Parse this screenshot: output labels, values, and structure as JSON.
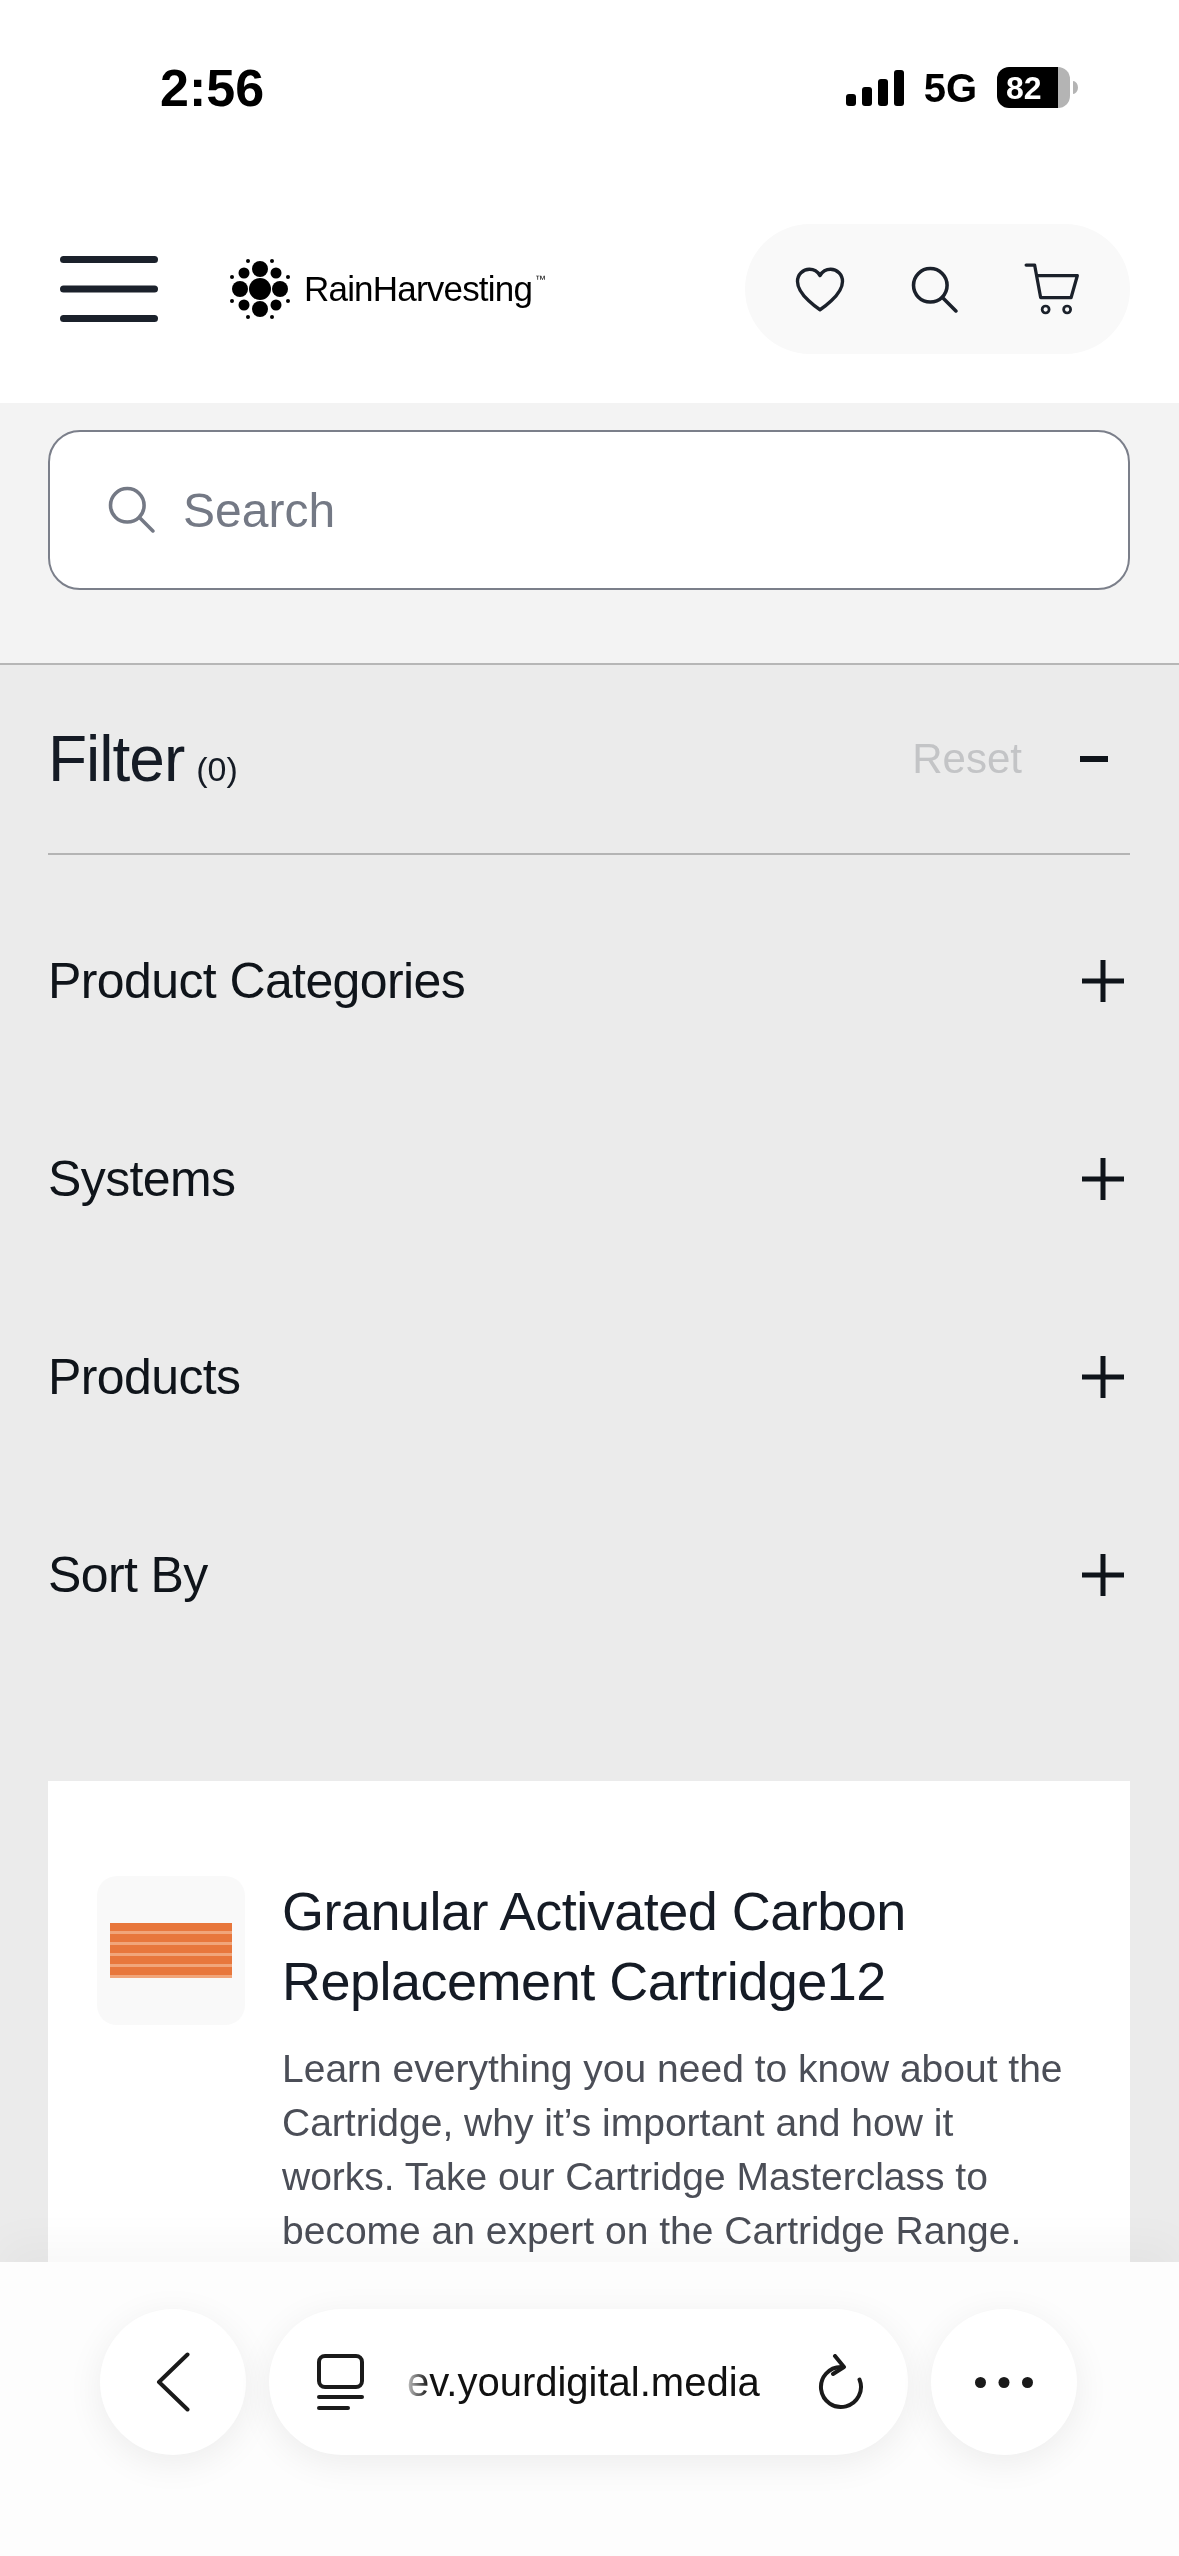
{
  "status_bar": {
    "time": "2:56",
    "network": "5G",
    "battery": "82"
  },
  "header": {
    "logo": "RainHarvesting$^{™}$"
  },
  "search": {
    "placeholder": "Search"
  },
  "filter": {
    "title": "Filter",
    "count": "(0)",
    "reset": {
      "label": "Reset",
      "disabled": true
    },
    "expanded": true,
    "sections": [
      {
        "label": "Product Categories",
        "expanded": false
      },
      {
        "label": "Systems",
        "expanded": false
      },
      {
        "label": "Products",
        "expanded": false
      },
      {
        "label": "Sort By",
        "expanded": false
      }
    ]
  },
  "product_card": {
    "title": "Granular Activated Carbon Replacement Cartridge12",
    "description": "Learn everything you need to know about the Cartridge, why it’s important and how it works. Take our Cartridge Masterclass to become an expert on the Cartridge Range."
  },
  "browser_toolbar": {
    "url": "ev.yourdigital.media"
  }
}
